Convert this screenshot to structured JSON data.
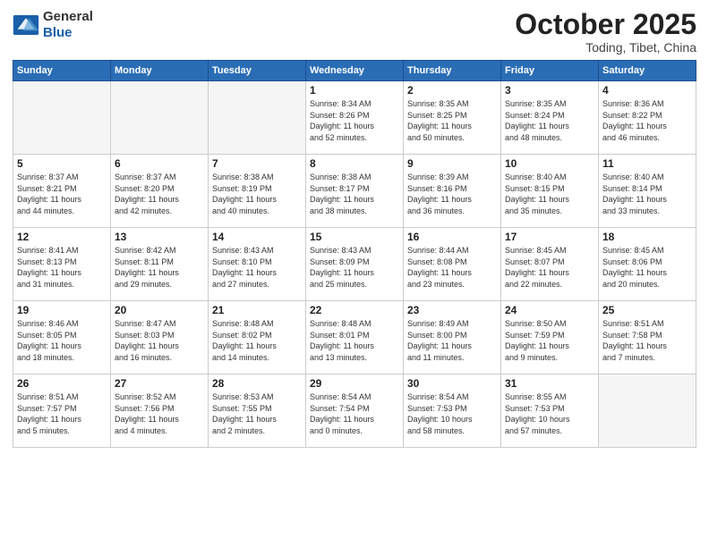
{
  "header": {
    "logo_general": "General",
    "logo_blue": "Blue",
    "title": "October 2025",
    "location": "Toding, Tibet, China"
  },
  "days_of_week": [
    "Sunday",
    "Monday",
    "Tuesday",
    "Wednesday",
    "Thursday",
    "Friday",
    "Saturday"
  ],
  "weeks": [
    [
      {
        "day": "",
        "info": ""
      },
      {
        "day": "",
        "info": ""
      },
      {
        "day": "",
        "info": ""
      },
      {
        "day": "1",
        "info": "Sunrise: 8:34 AM\nSunset: 8:26 PM\nDaylight: 11 hours\nand 52 minutes."
      },
      {
        "day": "2",
        "info": "Sunrise: 8:35 AM\nSunset: 8:25 PM\nDaylight: 11 hours\nand 50 minutes."
      },
      {
        "day": "3",
        "info": "Sunrise: 8:35 AM\nSunset: 8:24 PM\nDaylight: 11 hours\nand 48 minutes."
      },
      {
        "day": "4",
        "info": "Sunrise: 8:36 AM\nSunset: 8:22 PM\nDaylight: 11 hours\nand 46 minutes."
      }
    ],
    [
      {
        "day": "5",
        "info": "Sunrise: 8:37 AM\nSunset: 8:21 PM\nDaylight: 11 hours\nand 44 minutes."
      },
      {
        "day": "6",
        "info": "Sunrise: 8:37 AM\nSunset: 8:20 PM\nDaylight: 11 hours\nand 42 minutes."
      },
      {
        "day": "7",
        "info": "Sunrise: 8:38 AM\nSunset: 8:19 PM\nDaylight: 11 hours\nand 40 minutes."
      },
      {
        "day": "8",
        "info": "Sunrise: 8:38 AM\nSunset: 8:17 PM\nDaylight: 11 hours\nand 38 minutes."
      },
      {
        "day": "9",
        "info": "Sunrise: 8:39 AM\nSunset: 8:16 PM\nDaylight: 11 hours\nand 36 minutes."
      },
      {
        "day": "10",
        "info": "Sunrise: 8:40 AM\nSunset: 8:15 PM\nDaylight: 11 hours\nand 35 minutes."
      },
      {
        "day": "11",
        "info": "Sunrise: 8:40 AM\nSunset: 8:14 PM\nDaylight: 11 hours\nand 33 minutes."
      }
    ],
    [
      {
        "day": "12",
        "info": "Sunrise: 8:41 AM\nSunset: 8:13 PM\nDaylight: 11 hours\nand 31 minutes."
      },
      {
        "day": "13",
        "info": "Sunrise: 8:42 AM\nSunset: 8:11 PM\nDaylight: 11 hours\nand 29 minutes."
      },
      {
        "day": "14",
        "info": "Sunrise: 8:43 AM\nSunset: 8:10 PM\nDaylight: 11 hours\nand 27 minutes."
      },
      {
        "day": "15",
        "info": "Sunrise: 8:43 AM\nSunset: 8:09 PM\nDaylight: 11 hours\nand 25 minutes."
      },
      {
        "day": "16",
        "info": "Sunrise: 8:44 AM\nSunset: 8:08 PM\nDaylight: 11 hours\nand 23 minutes."
      },
      {
        "day": "17",
        "info": "Sunrise: 8:45 AM\nSunset: 8:07 PM\nDaylight: 11 hours\nand 22 minutes."
      },
      {
        "day": "18",
        "info": "Sunrise: 8:45 AM\nSunset: 8:06 PM\nDaylight: 11 hours\nand 20 minutes."
      }
    ],
    [
      {
        "day": "19",
        "info": "Sunrise: 8:46 AM\nSunset: 8:05 PM\nDaylight: 11 hours\nand 18 minutes."
      },
      {
        "day": "20",
        "info": "Sunrise: 8:47 AM\nSunset: 8:03 PM\nDaylight: 11 hours\nand 16 minutes."
      },
      {
        "day": "21",
        "info": "Sunrise: 8:48 AM\nSunset: 8:02 PM\nDaylight: 11 hours\nand 14 minutes."
      },
      {
        "day": "22",
        "info": "Sunrise: 8:48 AM\nSunset: 8:01 PM\nDaylight: 11 hours\nand 13 minutes."
      },
      {
        "day": "23",
        "info": "Sunrise: 8:49 AM\nSunset: 8:00 PM\nDaylight: 11 hours\nand 11 minutes."
      },
      {
        "day": "24",
        "info": "Sunrise: 8:50 AM\nSunset: 7:59 PM\nDaylight: 11 hours\nand 9 minutes."
      },
      {
        "day": "25",
        "info": "Sunrise: 8:51 AM\nSunset: 7:58 PM\nDaylight: 11 hours\nand 7 minutes."
      }
    ],
    [
      {
        "day": "26",
        "info": "Sunrise: 8:51 AM\nSunset: 7:57 PM\nDaylight: 11 hours\nand 5 minutes."
      },
      {
        "day": "27",
        "info": "Sunrise: 8:52 AM\nSunset: 7:56 PM\nDaylight: 11 hours\nand 4 minutes."
      },
      {
        "day": "28",
        "info": "Sunrise: 8:53 AM\nSunset: 7:55 PM\nDaylight: 11 hours\nand 2 minutes."
      },
      {
        "day": "29",
        "info": "Sunrise: 8:54 AM\nSunset: 7:54 PM\nDaylight: 11 hours\nand 0 minutes."
      },
      {
        "day": "30",
        "info": "Sunrise: 8:54 AM\nSunset: 7:53 PM\nDaylight: 10 hours\nand 58 minutes."
      },
      {
        "day": "31",
        "info": "Sunrise: 8:55 AM\nSunset: 7:53 PM\nDaylight: 10 hours\nand 57 minutes."
      },
      {
        "day": "",
        "info": ""
      }
    ]
  ]
}
